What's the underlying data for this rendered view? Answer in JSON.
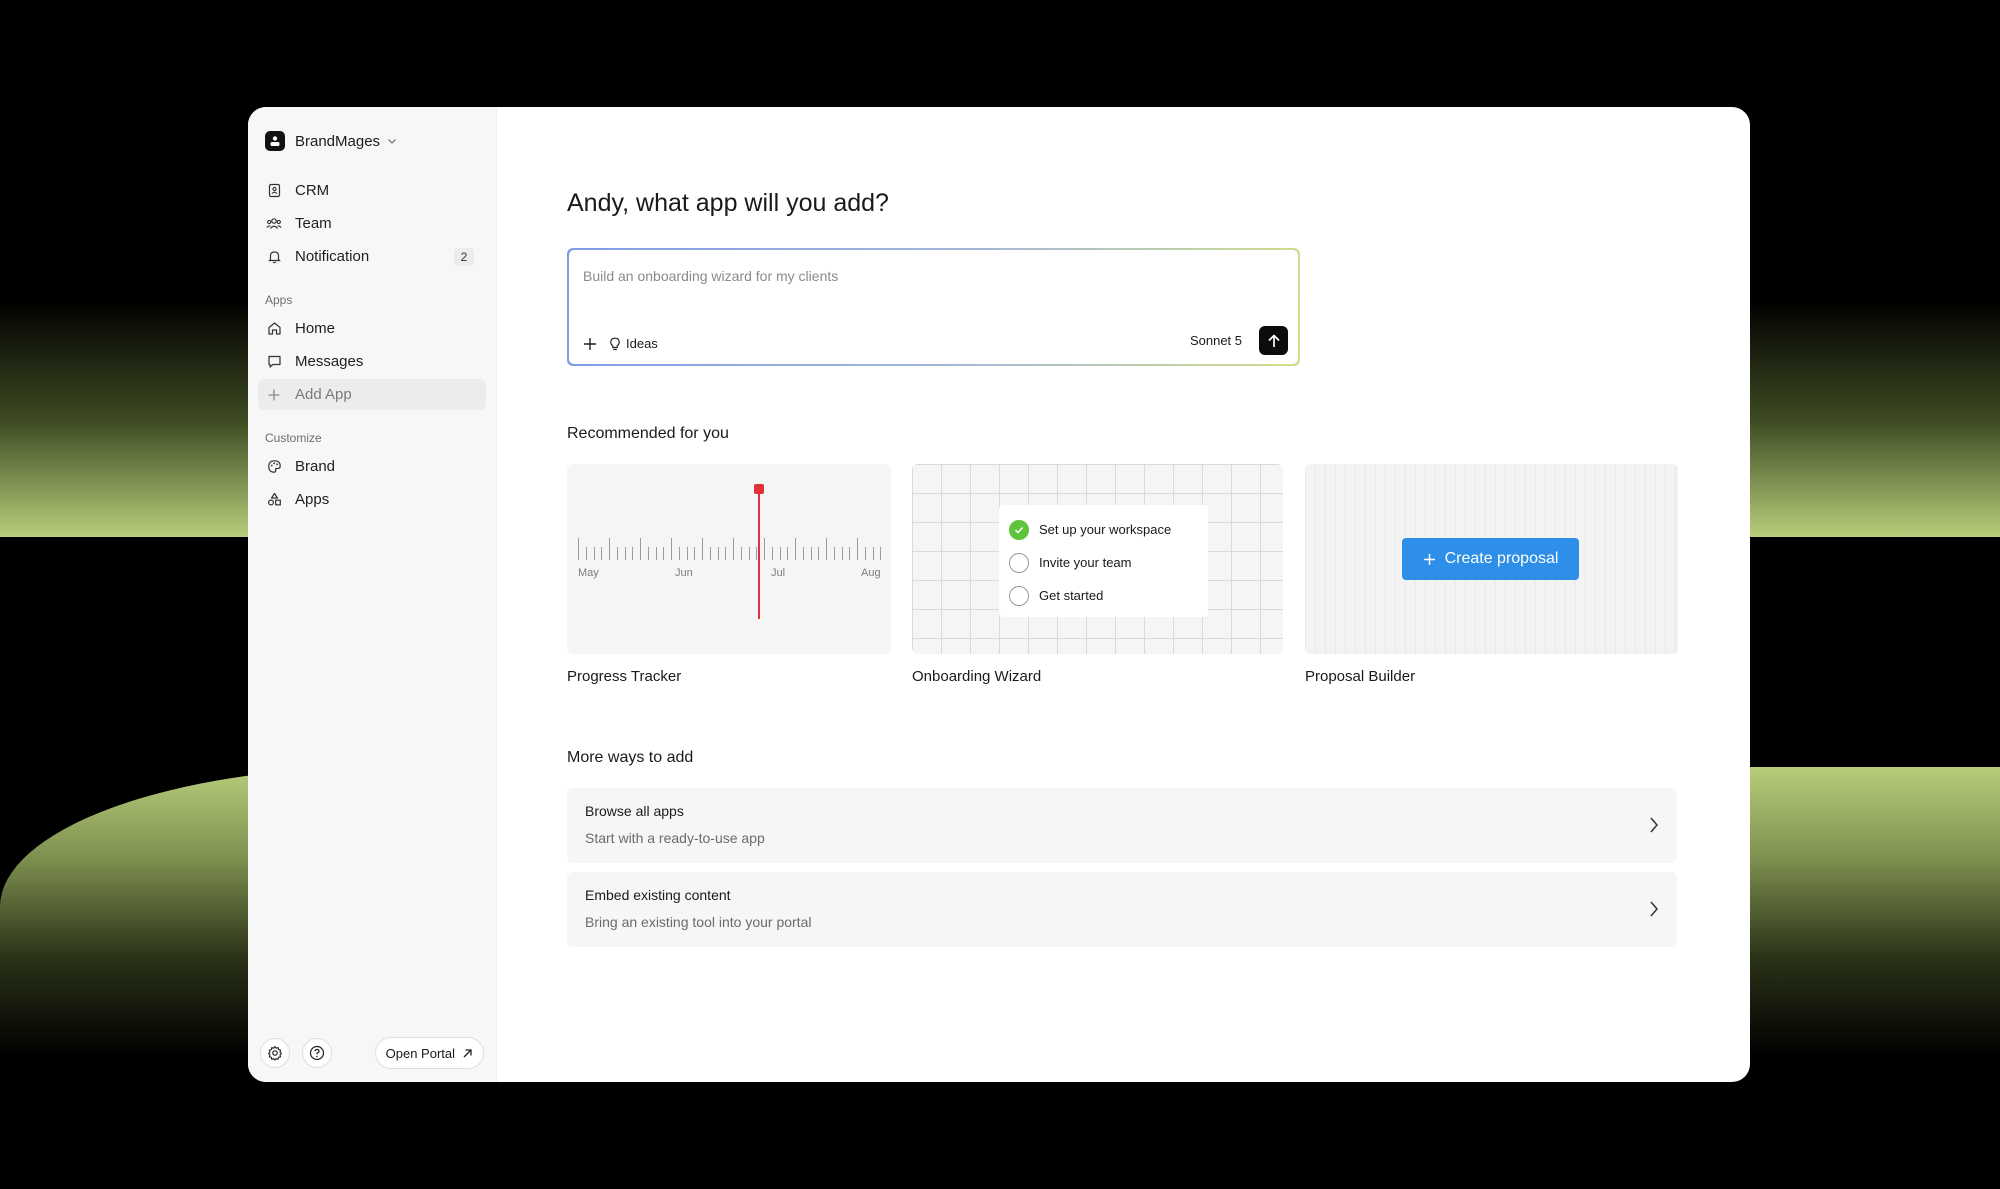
{
  "workspace": {
    "name": "BrandMages"
  },
  "sidebar": {
    "top_items": [
      {
        "label": "CRM",
        "icon": "contacts-icon"
      },
      {
        "label": "Team",
        "icon": "team-icon"
      },
      {
        "label": "Notification",
        "icon": "bell-icon",
        "badge": "2"
      }
    ],
    "apps_label": "Apps",
    "apps_items": [
      {
        "label": "Home",
        "icon": "home-icon"
      },
      {
        "label": "Messages",
        "icon": "message-icon"
      },
      {
        "label": "Add App",
        "icon": "plus-icon",
        "active": true
      }
    ],
    "customize_label": "Customize",
    "customize_items": [
      {
        "label": "Brand",
        "icon": "palette-icon"
      },
      {
        "label": "Apps",
        "icon": "shapes-icon"
      }
    ],
    "footer": {
      "open_portal": "Open Portal"
    }
  },
  "main": {
    "headline": "Andy, what app will you add?",
    "prompt": {
      "placeholder": "Build an onboarding wizard for my clients",
      "ideas_label": "Ideas",
      "model": "Sonnet 5"
    },
    "recommended_title": "Recommended for you",
    "cards": [
      {
        "title": "Progress Tracker",
        "timeline_months": [
          "May",
          "Jun",
          "Jul",
          "Aug"
        ]
      },
      {
        "title": "Onboarding Wizard",
        "steps": [
          {
            "label": "Set up your workspace",
            "done": true
          },
          {
            "label": "Invite your team",
            "done": false
          },
          {
            "label": "Get started",
            "done": false
          }
        ]
      },
      {
        "title": "Proposal Builder",
        "button": "Create proposal"
      }
    ],
    "more_title": "More ways to add",
    "options": [
      {
        "title": "Browse all apps",
        "subtitle": "Start with a ready-to-use app"
      },
      {
        "title": "Embed existing content",
        "subtitle": "Bring an existing tool into your portal"
      }
    ]
  },
  "colors": {
    "accent": "#2d8fe8",
    "playhead": "#e0303a",
    "success": "#5fc43b",
    "background_green": "#b7cd7a"
  }
}
